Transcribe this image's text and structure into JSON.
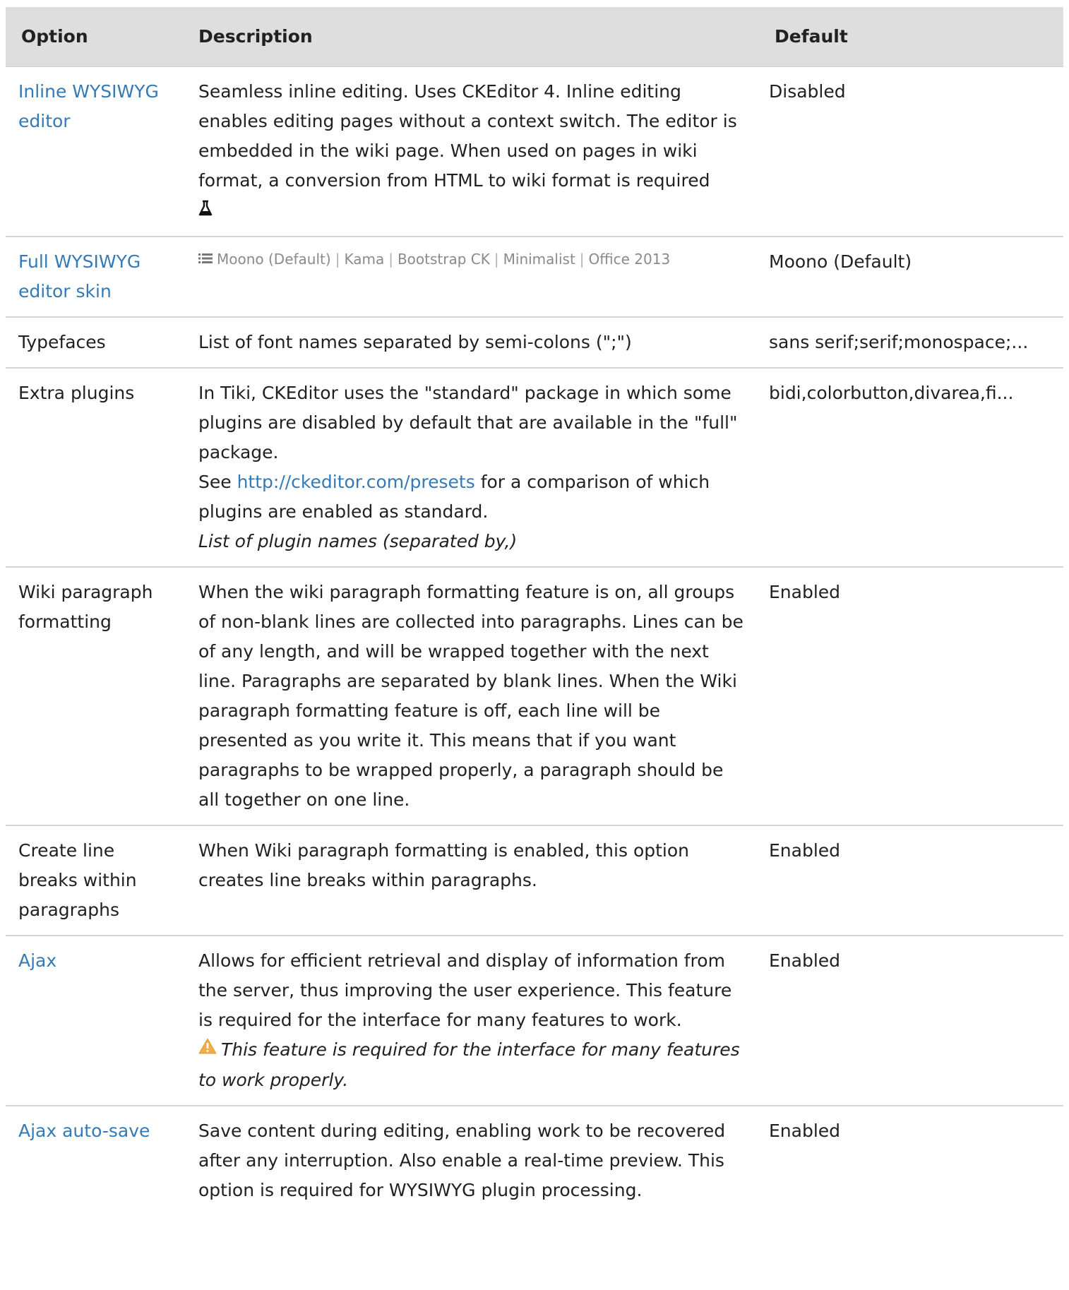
{
  "header": {
    "option": "Option",
    "description": "Description",
    "default": "Default"
  },
  "rows": [
    {
      "option": "Inline WYSIWYG editor",
      "option_is_link": true,
      "description": "Seamless inline editing. Uses CKEditor 4. Inline editing enables editing pages without a context switch. The editor is embedded in the wiki page. When used on pages in wiki format, a conversion from HTML to wiki format is required",
      "icon": "flask-icon",
      "default": "Disabled"
    },
    {
      "option": "Full WYSIWYG editor skin",
      "option_is_link": true,
      "skins": [
        "Moono (Default)",
        "Kama",
        "Bootstrap CK",
        "Minimalist",
        "Office 2013"
      ],
      "skin_separator": "|",
      "icon": "list-icon",
      "default": "Moono (Default)"
    },
    {
      "option": "Typefaces",
      "option_is_link": false,
      "description": "List of font names separated by semi-colons (\";\")",
      "default": "sans serif;serif;monospace;..."
    },
    {
      "option": "Extra plugins",
      "option_is_link": false,
      "description": "In Tiki, CKEditor uses the \"standard\" package in which some plugins are disabled by default that are available in the \"full\" package.",
      "see_prefix": "See ",
      "see_link": "http://ckeditor.com/presets",
      "see_suffix": " for a comparison of which plugins are enabled as standard.",
      "hint": "List of plugin names (separated by,)",
      "default": "bidi,colorbutton,divarea,fi..."
    },
    {
      "option": "Wiki paragraph formatting",
      "option_is_link": false,
      "description": "When the wiki paragraph formatting feature is on, all groups of non-blank lines are collected into paragraphs. Lines can be of any length, and will be wrapped together with the next line. Paragraphs are separated by blank lines. When the Wiki paragraph formatting feature is off, each line will be presented as you write it. This means that if you want paragraphs to be wrapped properly, a paragraph should be all together on one line.",
      "default": "Enabled"
    },
    {
      "option": "Create line breaks within paragraphs",
      "option_is_link": false,
      "description": "When Wiki paragraph formatting is enabled, this option creates line breaks within paragraphs.",
      "default": "Enabled"
    },
    {
      "option": "Ajax",
      "option_is_link": true,
      "description": "Allows for efficient retrieval and display of information from the server, thus improving the user experience. This feature is required for the interface for many features to work.",
      "warning": "This feature is required for the interface for many features to work properly.",
      "icon": "warning-icon",
      "default": "Enabled"
    },
    {
      "option": "Ajax auto-save",
      "option_is_link": true,
      "description": "Save content during editing, enabling work to be recovered after any interruption. Also enable a real-time preview. This option is required for WYSIWYG plugin processing.",
      "default": "Enabled"
    }
  ],
  "colors": {
    "link": "#337ab7",
    "header_bg": "#dedede",
    "warning": "#f0ad4e"
  }
}
